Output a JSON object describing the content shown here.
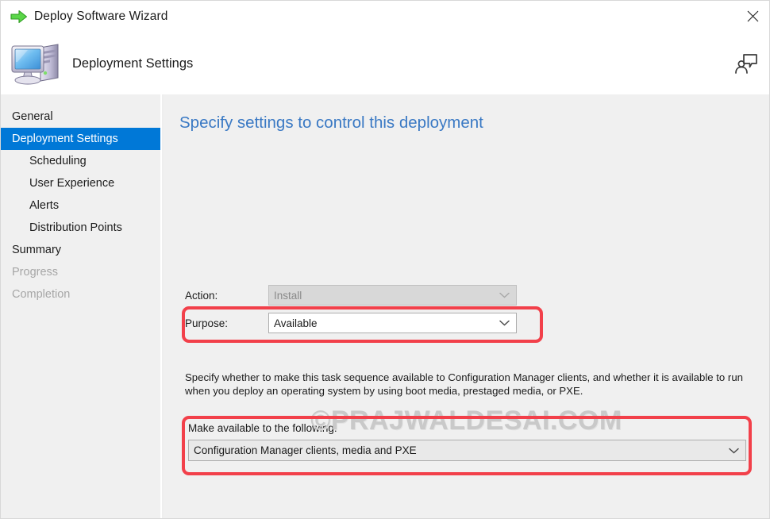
{
  "window": {
    "title": "Deploy Software Wizard",
    "title_icon": "green-arrow-icon",
    "close_label": "✕"
  },
  "header": {
    "title": "Deployment Settings",
    "icon": "computer-icon",
    "feedback_icon": "feedback-person-icon"
  },
  "sidebar": {
    "items": [
      {
        "label": "General",
        "state": "normal",
        "indent": false
      },
      {
        "label": "Deployment Settings",
        "state": "selected",
        "indent": false
      },
      {
        "label": "Scheduling",
        "state": "normal",
        "indent": true
      },
      {
        "label": "User Experience",
        "state": "normal",
        "indent": true
      },
      {
        "label": "Alerts",
        "state": "normal",
        "indent": true
      },
      {
        "label": "Distribution Points",
        "state": "normal",
        "indent": true
      },
      {
        "label": "Summary",
        "state": "normal",
        "indent": false
      },
      {
        "label": "Progress",
        "state": "disabled",
        "indent": false
      },
      {
        "label": "Completion",
        "state": "disabled",
        "indent": false
      }
    ]
  },
  "content": {
    "title": "Specify settings to control this deployment",
    "action": {
      "label": "Action:",
      "value": "Install",
      "disabled": true
    },
    "purpose": {
      "label": "Purpose:",
      "value": "Available",
      "disabled": false
    },
    "description": "Specify whether to make this task sequence available to Configuration Manager clients, and whether it is available to run when you deploy an operating system by using boot media, prestaged media, or PXE.",
    "availability": {
      "label": "Make available to the following:",
      "value": "Configuration Manager clients, media and PXE"
    }
  },
  "watermark": {
    "text": "©PRAJWALDESAI.COM"
  },
  "colors": {
    "accent_blue": "#0078d7",
    "title_blue": "#3a79c4",
    "highlight_red": "#f2404a",
    "body_gray": "#f0f0f0"
  }
}
